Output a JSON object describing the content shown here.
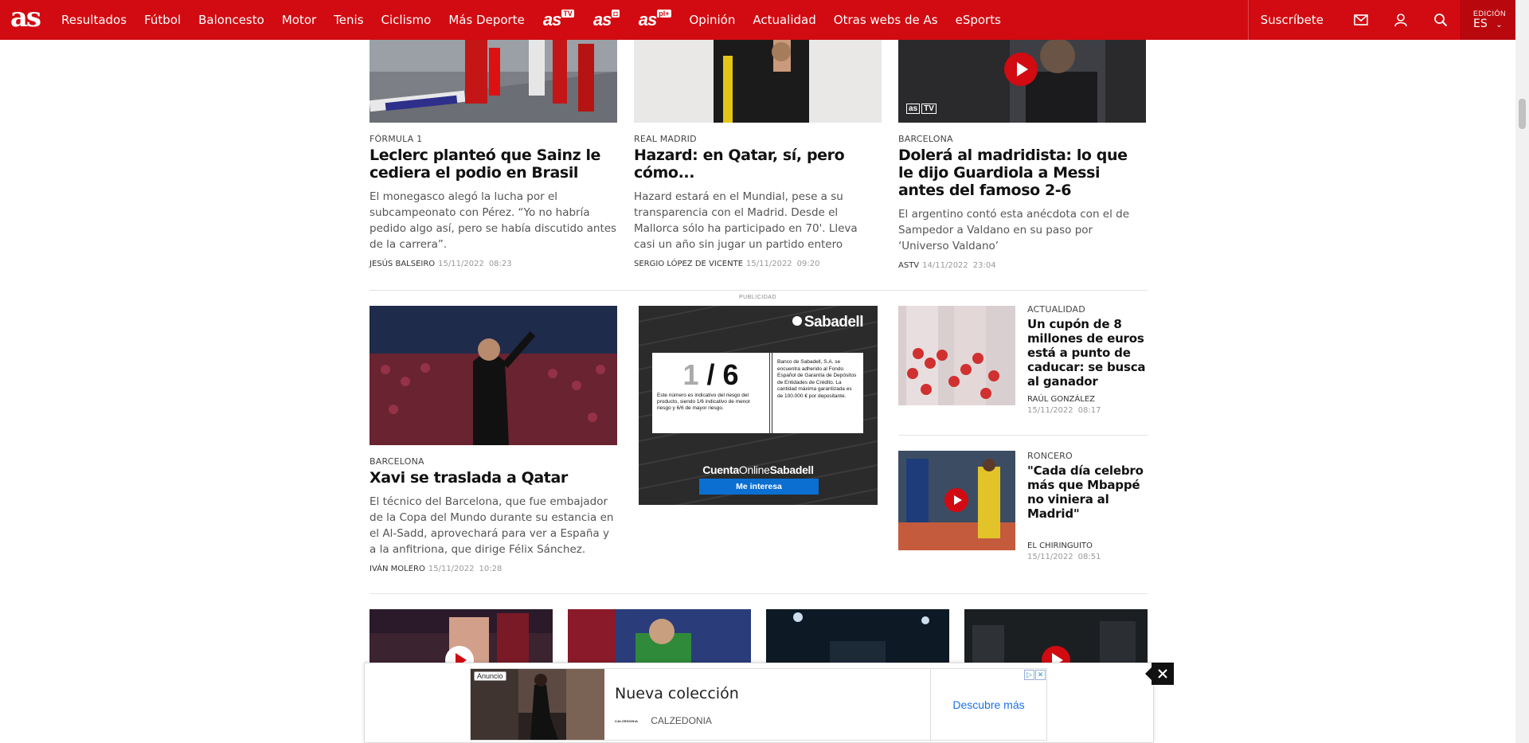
{
  "header": {
    "logo": "as",
    "nav": [
      "Resultados",
      "Fútbol",
      "Baloncesto",
      "Motor",
      "Tenis",
      "Ciclismo",
      "Más Deporte"
    ],
    "brand_links": [
      {
        "name": "as",
        "badge": "TV"
      },
      {
        "name": "as",
        "badge": "◘"
      },
      {
        "name": "as",
        "badge": "pl+"
      }
    ],
    "nav_after": [
      "Opinión",
      "Actualidad",
      "Otras webs de As",
      "eSports"
    ],
    "subscribe_label": "Suscríbete",
    "edition_label": "EDICIÓN",
    "edition_value": "ES",
    "accent_color": "#d20a11"
  },
  "row1": [
    {
      "section": "FÓRMULA 1",
      "headline": "Leclerc planteó que Sainz le cediera el podio en Brasil",
      "summary": "El monegasco alegó la lucha por el subcampeonato con Pérez. “Yo no habría pedido algo así, pero se había discutido antes de la carrera”.",
      "author": "JESÚS BALSEIRO",
      "date": "15/11/2022",
      "time": "08:23"
    },
    {
      "section": "REAL MADRID",
      "headline": "Hazard: en Qatar, sí, pero cómo...",
      "summary": "Hazard estará en el Mundial, pese a su transparencia con el Madrid. Desde el Mallorca sólo ha participado en 70'. Lleva casi un año sin jugar un partido entero",
      "author": "SERGIO LÓPEZ DE VICENTE",
      "date": "15/11/2022",
      "time": "09:20"
    },
    {
      "section": "BARCELONA",
      "headline": "Dolerá al madridista: lo que le dijo Guardiola a Messi antes del famoso 2-6",
      "summary": "El argentino contó esta anécdota con el de Sampedor a Valdano en su paso por ‘Universo Valdano’",
      "author": "ASTV",
      "date": "14/11/2022",
      "time": "23:04",
      "video_badge": "as",
      "video_badge_sub": "TV"
    }
  ],
  "feature": {
    "section": "BARCELONA",
    "headline": "Xavi se traslada a Qatar",
    "summary": "El técnico del Barcelona, que fue embajador de la Copa del Mundo durante su estancia en el Al-Sadd, aprovechará para ver a España y a la anfitriona, que dirige Félix Sánchez.",
    "author": "IVÁN MOLERO",
    "date": "15/11/2022",
    "time": "10:28"
  },
  "ad": {
    "label": "PUBLICIDAD",
    "brand": "Sabadell",
    "risk_one": "1",
    "risk_slash": "/",
    "risk_six": "6",
    "risk_text": "Este número es indicativo del riesgo del producto, siendo 1/6 indicativo de menor riesgo y 6/6 de mayor riesgo.",
    "legal_text": "Banco de Sabadell, S.A. se encuentra adherido al Fondo Español de Garantía de Depósitos de Entidades de Crédito. La cantidad máxima garantizada es de 100.000 € por depositante.",
    "product_a": "Cuenta",
    "product_b": "Online",
    "product_c": "Sabadell",
    "cta": "Me interesa"
  },
  "side": [
    {
      "section": "ACTUALIDAD",
      "headline": "Un cupón de 8 millones de euros está a punto de caducar: se busca al ganador",
      "author": "RAÚL GONZÁLEZ",
      "date": "15/11/2022",
      "time": "08:17"
    },
    {
      "section": "RONCERO",
      "headline": "\"Cada día celebro más que Mbappé no viniera al Madrid\"",
      "author": "EL CHIRINGUITO",
      "date": "15/11/2022",
      "time": "08:51"
    }
  ],
  "sticky_ad": {
    "badge": "Anuncio",
    "title": "Nueva colección",
    "brand_small": "CALZEDONIA",
    "brand": "CALZEDONIA",
    "cta": "Descubre más"
  }
}
